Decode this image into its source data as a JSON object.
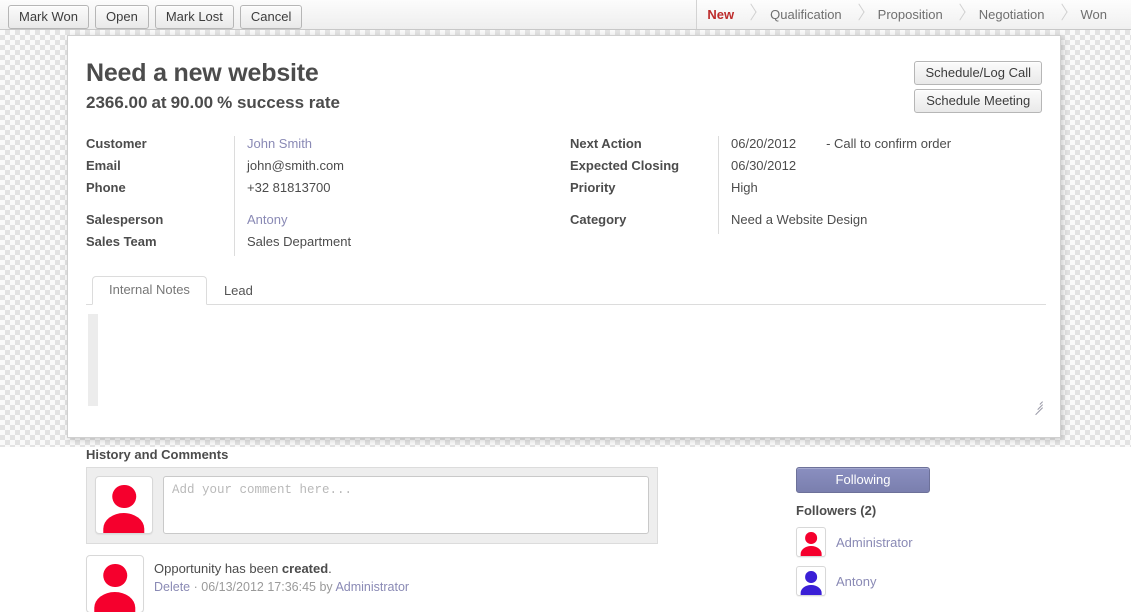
{
  "toolbar": {
    "buttons": [
      {
        "label": "Mark Won"
      },
      {
        "label": "Open"
      },
      {
        "label": "Mark Lost"
      },
      {
        "label": "Cancel"
      }
    ]
  },
  "stages": {
    "items": [
      {
        "label": "New",
        "active": true
      },
      {
        "label": "Qualification",
        "active": false
      },
      {
        "label": "Proposition",
        "active": false
      },
      {
        "label": "Negotiation",
        "active": false
      },
      {
        "label": "Won",
        "active": false
      }
    ],
    "active_color": "#bd2c2c"
  },
  "record": {
    "title": "Need a new website",
    "amount": "2366.00",
    "at": "at",
    "probability": "90.00",
    "rate_suffix": "% success rate"
  },
  "header_buttons": {
    "schedule_call": "Schedule/Log Call",
    "schedule_meeting": "Schedule Meeting"
  },
  "fields_left": [
    {
      "label": "Customer",
      "value": "John Smith",
      "link": true
    },
    {
      "label": "Email",
      "value": "john@smith.com",
      "link": false
    },
    {
      "label": "Phone",
      "value": "+32 81813700",
      "link": false
    },
    {
      "label": "Salesperson",
      "value": "Antony",
      "link": true,
      "group_start": true
    },
    {
      "label": "Sales Team",
      "value": "Sales Department",
      "link": false
    }
  ],
  "fields_right": [
    {
      "label": "Next Action",
      "value": "06/20/2012",
      "extra": "- Call to confirm order",
      "link": false
    },
    {
      "label": "Expected Closing",
      "value": "06/30/2012",
      "link": false
    },
    {
      "label": "Priority",
      "value": "High",
      "link": false
    },
    {
      "label": "Category",
      "value": "Need a Website Design",
      "link": false,
      "group_start": true
    }
  ],
  "tabs": [
    {
      "label": "Internal Notes",
      "active": true
    },
    {
      "label": "Lead",
      "active": false
    }
  ],
  "notes": {
    "value": "",
    "placeholder": ""
  },
  "history": {
    "section_title": "History and Comments",
    "comment_placeholder": "Add your comment here...",
    "comment_value": "",
    "entries": [
      {
        "text_prefix": "Opportunity has been ",
        "text_bold": "created",
        "text_suffix": ".",
        "delete_label": "Delete",
        "separator": "·",
        "timestamp": "06/13/2012 17:36:45 by",
        "author": "Administrator",
        "avatar_color": "red"
      }
    ]
  },
  "followers": {
    "following_label": "Following",
    "following_color": "#7f84b3",
    "count_label": "Followers (2)",
    "list": [
      {
        "name": "Administrator",
        "avatar_color": "red"
      },
      {
        "name": "Antony",
        "avatar_color": "blue"
      }
    ]
  }
}
